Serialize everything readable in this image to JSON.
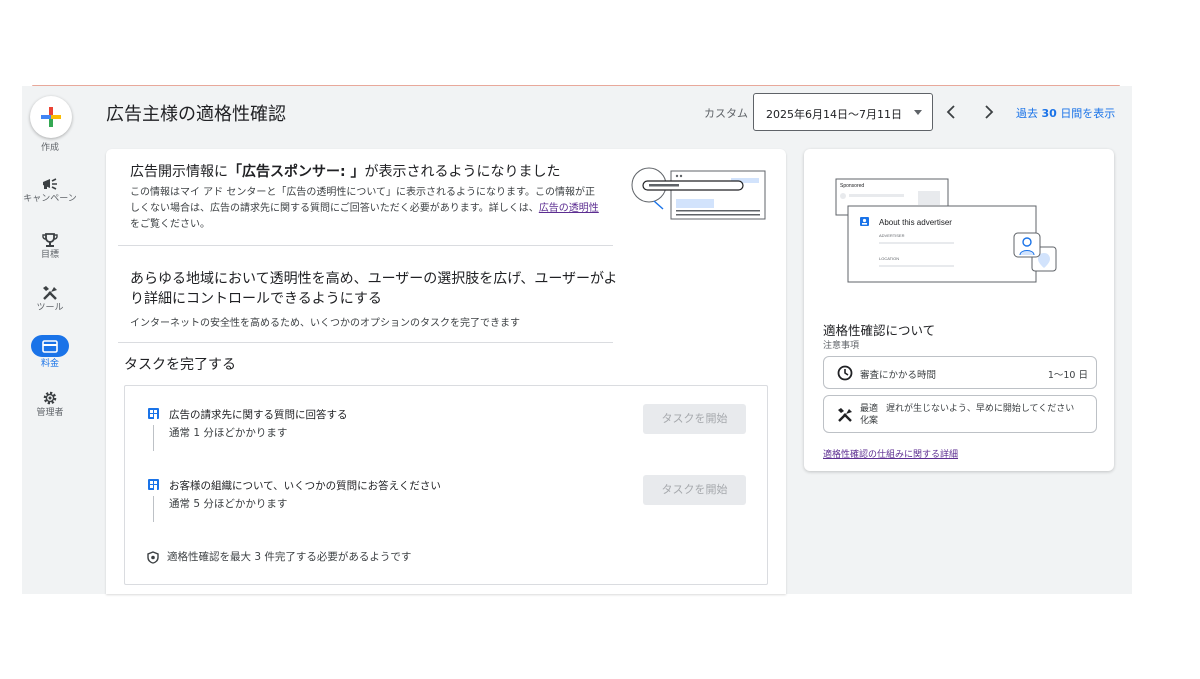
{
  "sidebar": {
    "create_label": "作成",
    "items": [
      {
        "label": "キャンペーン",
        "icon": "megaphone-icon"
      },
      {
        "label": "目標",
        "icon": "trophy-icon"
      },
      {
        "label": "ツール",
        "icon": "tools-icon"
      },
      {
        "label": "料金",
        "icon": "billing-card-icon",
        "active": true
      },
      {
        "label": "管理者",
        "icon": "gear-icon"
      }
    ]
  },
  "header": {
    "title": "広告主様の適格性確認",
    "custom_label": "カスタム",
    "date_range": "2025年6月14日〜7月11日",
    "view_30_prefix": "過去",
    "view_30_bold": "30",
    "view_30_suffix": "日間を表示"
  },
  "banner": {
    "title_prefix": "広告開示情報に",
    "title_bold": "「広告スポンサー: 」",
    "title_suffix": "が表示されるようになりました",
    "desc_prefix": "この情報はマイ アド センターと「広告の透明性について」に表示されるようになります。この情報が正しくない場合は、広告の請求先に関する質問にご回答いただく必要があります。詳しくは、",
    "desc_link": "広告の透明性",
    "desc_suffix": "をご覧ください。"
  },
  "section": {
    "title": "あらゆる地域において透明性を高め、ユーザーの選択肢を広げ、ユーザーがより詳細にコントロールできるようにする",
    "desc": "インターネットの安全性を高めるため、いくつかのオプションのタスクを完了できます"
  },
  "tasks": {
    "title": "タスクを完了する",
    "items": [
      {
        "name": "広告の請求先に関する質問に回答する",
        "time": "通常 1 分ほどかかります",
        "button": "タスクを開始"
      },
      {
        "name": "お客様の組織について、いくつかの質問にお答えください",
        "time": "通常 5 分ほどかかります",
        "button": "タスクを開始"
      }
    ],
    "note": "適格性確認を最大 3 件完了する必要があるようです"
  },
  "side": {
    "illustration": {
      "sponsored": "Sponsored",
      "about": "About this advertiser",
      "advertiser": "ADVERTISER",
      "location": "LOCATION"
    },
    "title": "適格性確認について",
    "subtitle": "注意事項",
    "review_label": "審査にかかる時間",
    "review_value": "1〜10 日",
    "tip_label": "最適化案",
    "tip_text": "遅れが生じないよう、早めに開始してください",
    "link": "適格性確認の仕組みに関する詳細"
  },
  "colors": {
    "accent": "#1a73e8",
    "link": "#5c2d91",
    "disabled_button": "#e8eaed"
  }
}
